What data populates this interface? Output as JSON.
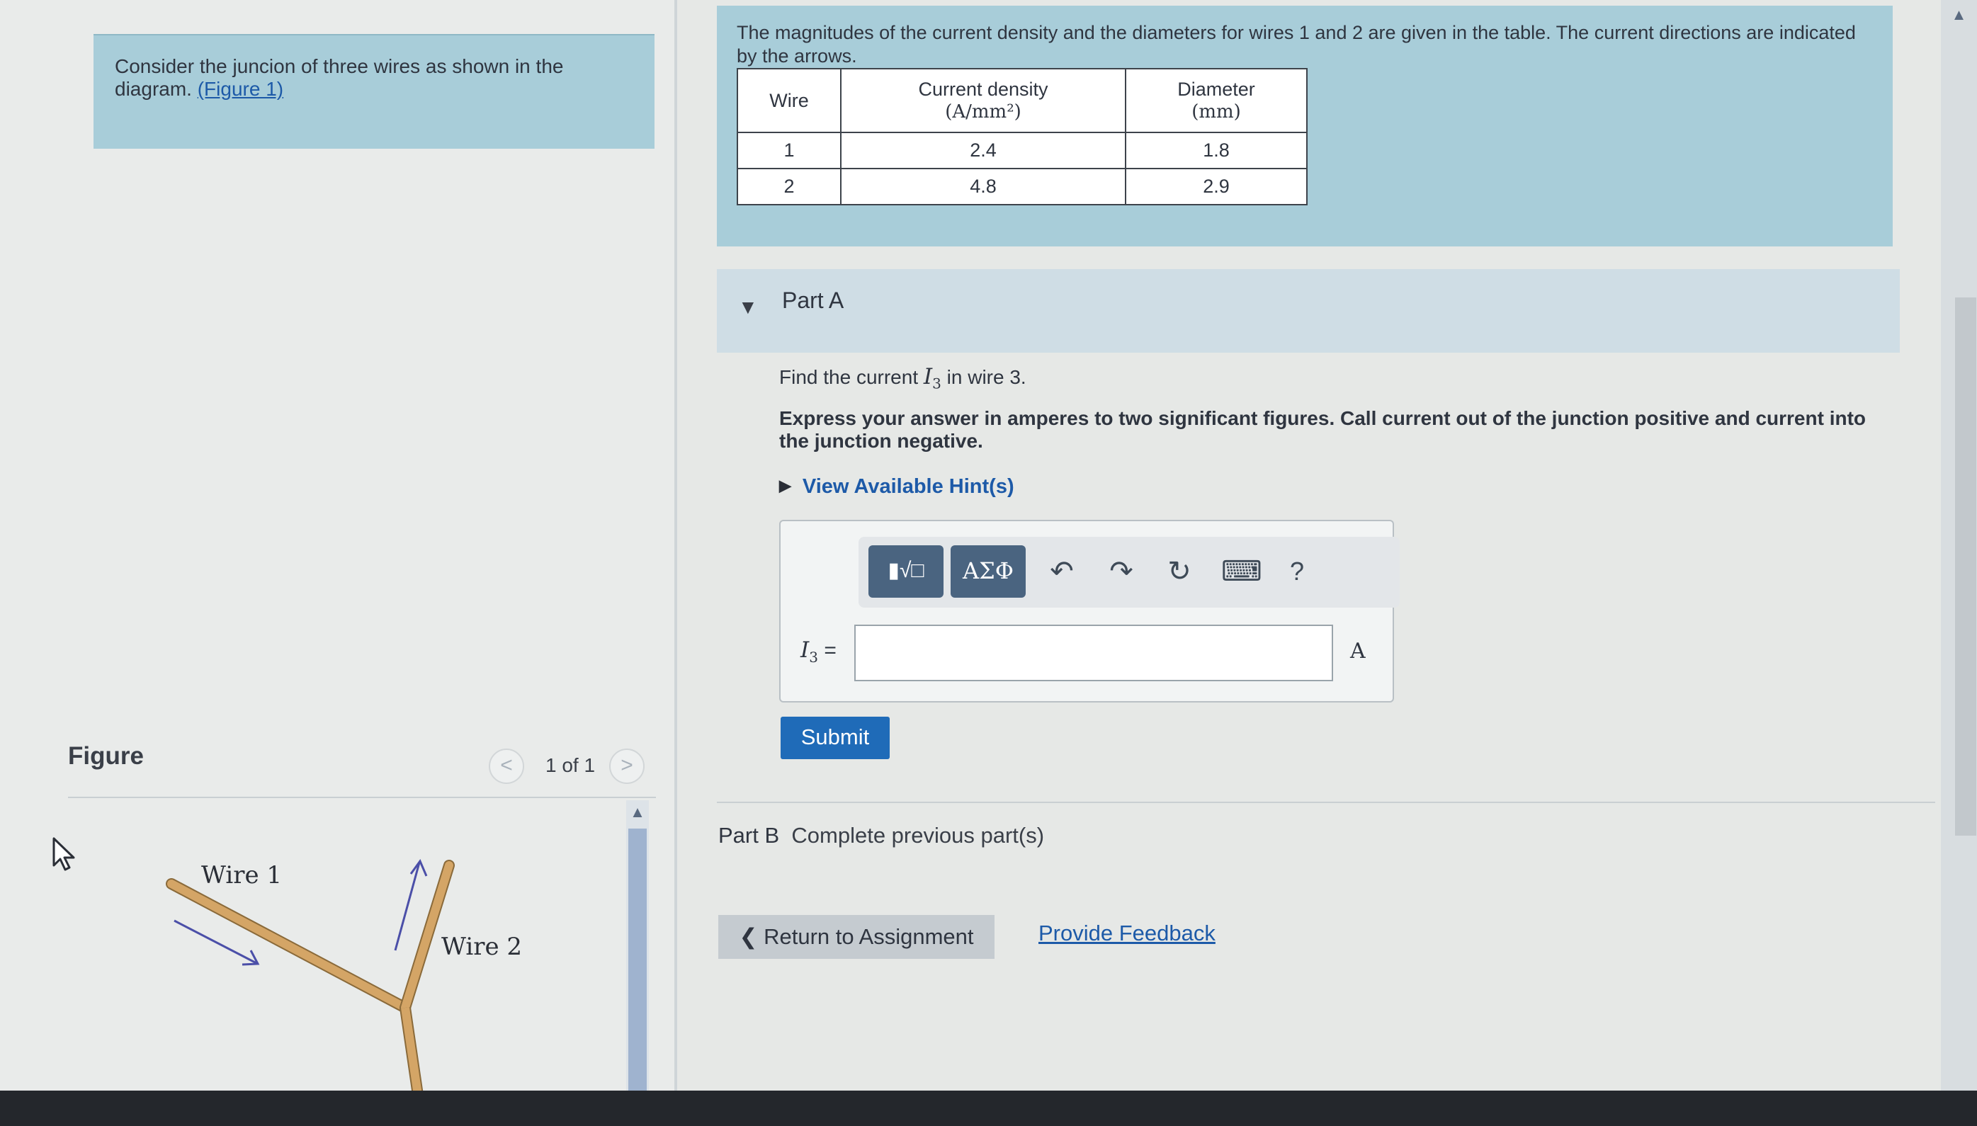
{
  "left": {
    "intro_text": "Consider the juncion of three wires as shown in the diagram.",
    "intro_link": "(Figure 1)",
    "figure_label": "Figure",
    "figure_counter": "1 of 1",
    "prev_glyph": "<",
    "next_glyph": ">",
    "wire1_label": "Wire 1",
    "wire2_label": "Wire 2"
  },
  "problem": {
    "text": "The magnitudes of the current density and the diameters for wires 1 and 2 are given in the table. The current directions are indicated by the arrows.",
    "table": {
      "headers": {
        "wire": "Wire",
        "current_density": "Current density",
        "current_density_unit": "(A/mm²)",
        "diameter": "Diameter",
        "diameter_unit": "(mm)"
      },
      "rows": [
        {
          "wire": "1",
          "current_density": "2.4",
          "diameter": "1.8"
        },
        {
          "wire": "2",
          "current_density": "4.8",
          "diameter": "2.9"
        }
      ]
    }
  },
  "partA": {
    "title": "Part A",
    "question_prefix": "Find the current",
    "question_var": "I",
    "question_sub": "3",
    "question_suffix": "in wire 3.",
    "instructions": "Express your answer in amperes to two significant figures. Call current out of the junction positive and current into the junction negative.",
    "hint_link": "View Available Hint(s)",
    "toolbar": {
      "templates_glyph": "▮√□",
      "greek_label": "ΑΣΦ",
      "undo_glyph": "↶",
      "redo_glyph": "↷",
      "reset_glyph": "↻",
      "keyboard_glyph": "⌨",
      "help_glyph": "?"
    },
    "input_var": "I",
    "input_sub": "3",
    "input_eq": "=",
    "input_value": "",
    "unit": "A",
    "submit_label": "Submit"
  },
  "partB": {
    "label": "Part B",
    "status": "Complete previous part(s)"
  },
  "footer": {
    "return_label": "Return to Assignment",
    "return_glyph": "❮",
    "feedback_label": "Provide Feedback"
  },
  "colors": {
    "panel_blue": "#a8cdd9",
    "link_blue": "#1d5aa8",
    "submit_blue": "#1f6bb8",
    "wire_tan": "#d4a566",
    "arrow_violet": "#4b4fa8"
  }
}
